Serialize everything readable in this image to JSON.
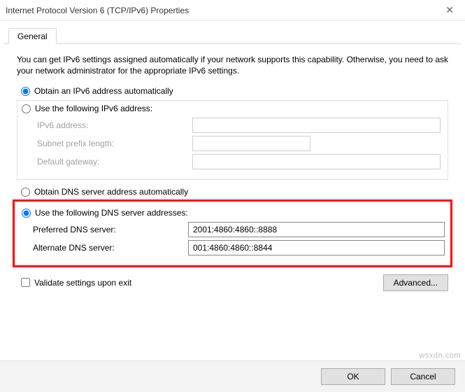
{
  "window": {
    "title": "Internet Protocol Version 6 (TCP/IPv6) Properties"
  },
  "tab": {
    "general": "General"
  },
  "description": "You can get IPv6 settings assigned automatically if your network supports this capability. Otherwise, you need to ask your network administrator for the appropriate IPv6 settings.",
  "ip": {
    "auto_label": "Obtain an IPv6 address automatically",
    "manual_label": "Use the following IPv6 address:",
    "address_label": "IPv6 address:",
    "prefix_label": "Subnet prefix length:",
    "gateway_label": "Default gateway:",
    "address_value": "",
    "prefix_value": "",
    "gateway_value": ""
  },
  "dns": {
    "auto_label": "Obtain DNS server address automatically",
    "manual_label": "Use the following DNS server addresses:",
    "preferred_label": "Preferred DNS server:",
    "alternate_label": "Alternate DNS server:",
    "preferred_value": "2001:4860:4860::8888",
    "alternate_value": "001:4860:4860::8844"
  },
  "validate_label": "Validate settings upon exit",
  "buttons": {
    "advanced": "Advanced...",
    "ok": "OK",
    "cancel": "Cancel"
  },
  "watermark": "wsxdn.com"
}
